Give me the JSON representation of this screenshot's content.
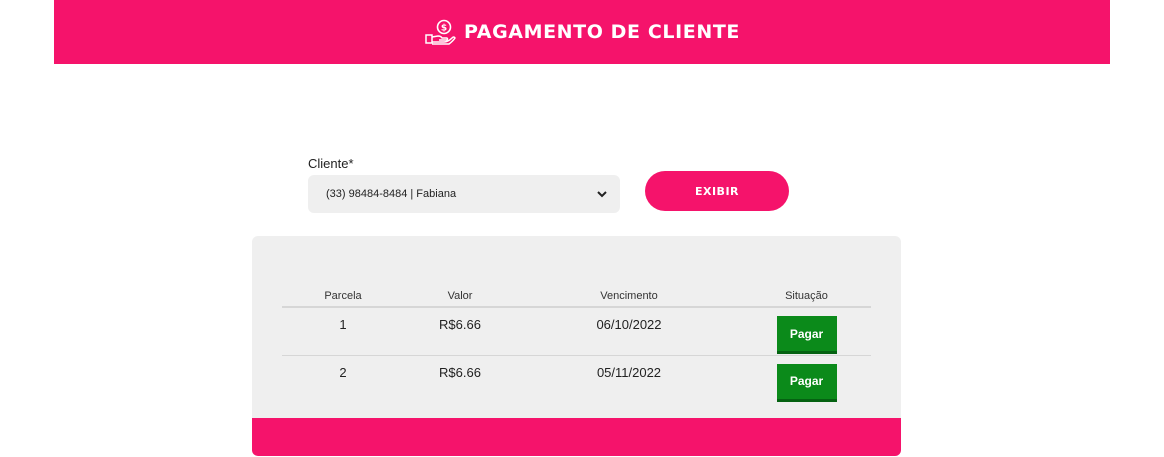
{
  "header": {
    "title": "PAGAMENTO DE CLIENTE",
    "icon": "hand-coin-icon",
    "background": "#f5136b"
  },
  "form": {
    "client_label": "Cliente*",
    "client_selected": "(33) 98484-8484 | Fabiana",
    "submit_label": "EXIBIR"
  },
  "table": {
    "headers": {
      "parcela": "Parcela",
      "valor": "Valor",
      "vencimento": "Vencimento",
      "situacao": "Situação"
    },
    "rows": [
      {
        "parcela": "1",
        "valor": "R$6.66",
        "vencimento": "06/10/2022",
        "action": "Pagar"
      },
      {
        "parcela": "2",
        "valor": "R$6.66",
        "vencimento": "05/11/2022",
        "action": "Pagar"
      }
    ]
  },
  "colors": {
    "accent": "#f5136b",
    "pay_button": "#0b8a1a"
  }
}
